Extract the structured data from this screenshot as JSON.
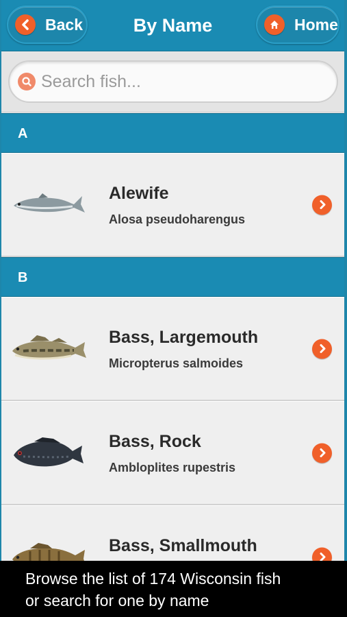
{
  "header": {
    "back_label": "Back",
    "title": "By Name",
    "home_label": "Home"
  },
  "search": {
    "placeholder": "Search fish..."
  },
  "sections": [
    {
      "letter": "A",
      "items": [
        {
          "name": "Alewife",
          "scientific": "Alosa pseudoharengus",
          "icon": "alewife-image"
        }
      ]
    },
    {
      "letter": "B",
      "items": [
        {
          "name": "Bass, Largemouth",
          "scientific": "Micropterus salmoides",
          "icon": "largemouth-bass-image"
        },
        {
          "name": "Bass, Rock",
          "scientific": "Ambloplites rupestris",
          "icon": "rock-bass-image"
        },
        {
          "name": "Bass, Smallmouth",
          "scientific": "",
          "icon": "smallmouth-bass-image"
        }
      ]
    }
  ],
  "caption": {
    "line1": "Browse the list of 174 Wisconsin fish",
    "line2": "or search for one by name"
  },
  "colors": {
    "header_blue": "#1a8bb3",
    "accent_orange": "#f0602a",
    "list_background": "#efefef"
  }
}
